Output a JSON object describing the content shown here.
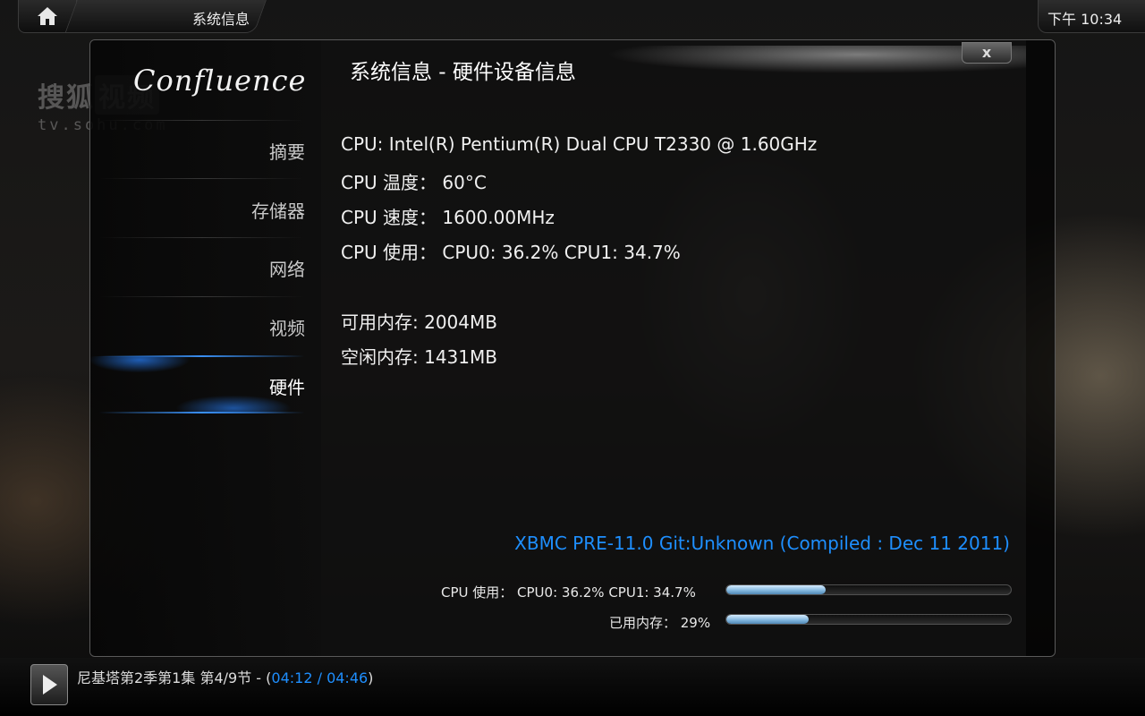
{
  "topbar": {
    "window_title": "系统信息",
    "clock": "下午 10:34"
  },
  "watermark": {
    "line1_a": "搜狐",
    "line1_b": "视频",
    "line2": "tv.sohu.com"
  },
  "sidebar": {
    "logo": "Confluence",
    "items": [
      {
        "label": "摘要"
      },
      {
        "label": "存储器"
      },
      {
        "label": "网络"
      },
      {
        "label": "视频"
      },
      {
        "label": "硬件"
      }
    ],
    "active_index": 4
  },
  "dialog": {
    "title": "系统信息 - 硬件设备信息",
    "close_label": "x",
    "info": {
      "cpu": "CPU: Intel(R) Pentium(R) Dual  CPU  T2330  @ 1.60GHz",
      "cpu_temp": "CPU 温度： 60°C",
      "cpu_speed": "CPU 速度： 1600.00MHz",
      "cpu_usage": "CPU 使用： CPU0: 36.2% CPU1: 34.7%",
      "mem_available": "可用内存: 2004MB",
      "mem_free": "空闲内存: 1431MB"
    },
    "build": "XBMC PRE-11.0 Git:Unknown (Compiled : Dec 11 2011)",
    "stats": {
      "cpu_label": "CPU 使用： CPU0: 36.2% CPU1: 34.7%",
      "cpu_fraction": 0.35,
      "mem_label": "已用内存： 29%",
      "mem_fraction": 0.29
    }
  },
  "now_playing": {
    "title": "尼基塔第2季第1集 第4/9节 - (",
    "time": "04:12 / 04:46",
    "suffix": ")"
  },
  "colors": {
    "accent": "#1e8fff",
    "progress_fill": "#7fb4dc"
  }
}
